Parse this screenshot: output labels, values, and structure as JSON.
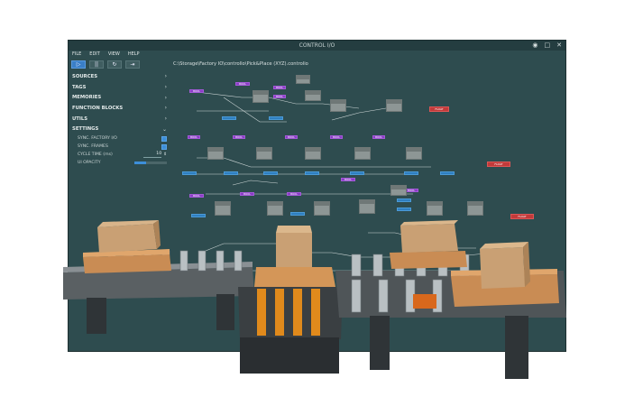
{
  "window": {
    "title": "CONTROL I/O"
  },
  "menu": [
    "FILE",
    "EDIT",
    "VIEW",
    "HELP"
  ],
  "toolbar": {
    "play": "▷",
    "pause": "||",
    "reload": "↻",
    "step": "⇥"
  },
  "path": "C:\\Storage\\Factory IO\\controllo\\Pick&Place (XYZ).controlio",
  "sidebar": {
    "sections": [
      "SOURCES",
      "TAGS",
      "MEMORIES",
      "FUNCTION BLOCKS",
      "UTILS",
      "SETTINGS"
    ],
    "settings": {
      "sync_factory": "SYNC. FACTORY I/O",
      "sync_frames": "SYNC. FRAMES",
      "cycle_time_label": "CYCLE TIME (ms)",
      "cycle_time_value": "10",
      "ui_opacity": "UI OPACITY",
      "ui_opacity_level": 0.35
    }
  },
  "colors": {
    "window_bg": "#2e4c4f",
    "accent": "#3d8fd9",
    "node_in": "#8b3cc7",
    "node_out": "#2f7fc0",
    "node_alarm": "#c23a3a"
  },
  "graph": {
    "input_tags": [
      "BOOL",
      "BOOL",
      "BOOL",
      "BOOL",
      "BOOL",
      "BOOL",
      "BOOL",
      "BOOL",
      "BOOL",
      "BOOL",
      "BOOL",
      "BOOL",
      "BOOL",
      "BOOL"
    ],
    "output_tags": [
      "FLOAT",
      "FLOAT",
      "FLOAT"
    ]
  }
}
